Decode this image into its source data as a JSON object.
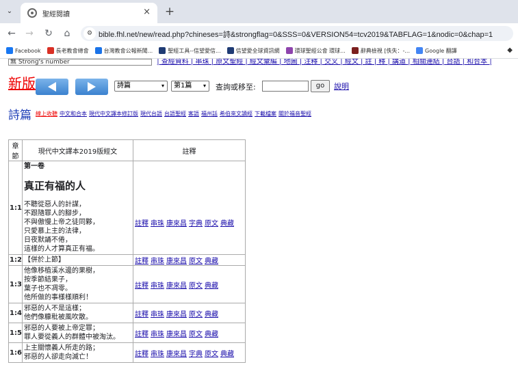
{
  "browser": {
    "tab_title": "聖經閱讀",
    "url": "bible.fhl.net/new/read.php?chineses=詩&strongflag=0&SSS=0&VERSION54=tcv2019&TABFLAG=1&nodic=0&chap=1",
    "bookmarks": [
      {
        "label": "Facebook",
        "color": "#1877f2"
      },
      {
        "label": "長老教會總會",
        "color": "#d93025"
      },
      {
        "label": "台灣教會公報新聞...",
        "color": "#1a73e8"
      },
      {
        "label": "聖經工具--信望愛信...",
        "color": "#1f3b74"
      },
      {
        "label": "信望愛全球資訊網",
        "color": "#1f3b74"
      },
      {
        "label": "環球聖經公會 環球...",
        "color": "#8e44ad"
      },
      {
        "label": "辭典檢視 [佚失：-...",
        "color": "#7b1f1f"
      },
      {
        "label": "Google 翻譯",
        "color": "#4285f4"
      }
    ]
  },
  "page": {
    "cutoff_select": "無 Strong's number",
    "cutoff_links": "| 查經資料 | 串珠 | 原文聖經 | 經文彙編 | 地圖 | 注釋 | 交叉 | 經文 | 註 | 釋 | 講道 | 相關連結 | 台語 | 和合本 |",
    "new_version": "新版",
    "book_select": "詩篇",
    "chapter_select": "第1篇",
    "goto_label": "查詢或移至:",
    "goto_value": "",
    "go_button": "go",
    "help_link": "說明",
    "book_title": "詩篇",
    "book_links": [
      {
        "label": "線上收聽",
        "red": true
      },
      {
        "label": "中文和合本",
        "red": false
      },
      {
        "label": "現代中文譯本修訂版",
        "red": false
      },
      {
        "label": "現代台語",
        "red": false
      },
      {
        "label": "台語聖經",
        "red": false
      },
      {
        "label": "客語",
        "red": false
      },
      {
        "label": "福州話",
        "red": false
      },
      {
        "label": "希伯來文讀經",
        "red": false
      },
      {
        "label": "下載檔案",
        "red": false
      },
      {
        "label": "關於福音聖經",
        "red": false
      }
    ]
  },
  "table": {
    "col_verse": "章節",
    "col_text": "現代中文譯本2019版經文",
    "col_notes": "註釋",
    "juan": "第一卷",
    "heading": "真正有福的人",
    "verses": [
      {
        "num": "1:1",
        "lines": [
          "不聽從惡人的計謀，",
          "不跟隨罪人的腳步，",
          "不與傲慢上帝之徒同夥，",
          "只愛慕上主的法律，",
          "日夜默誦不倦，",
          "這樣的人才算真正有福。"
        ],
        "notes": [
          "註釋",
          "串珠",
          "康來昌",
          "字典",
          "原文",
          "典藏"
        ]
      },
      {
        "num": "1:2",
        "lines": [
          "【併於上節】"
        ],
        "notes": [
          "註釋",
          "串珠",
          "康來昌",
          "原文",
          "典藏"
        ]
      },
      {
        "num": "1:3",
        "lines": [
          "他像移植溪水邊的果樹，",
          "按季節結果子，",
          "葉子也不凋零。",
          "他所做的事樣樣順利！"
        ],
        "notes": [
          "註釋",
          "串珠",
          "康來昌",
          "原文",
          "典藏"
        ]
      },
      {
        "num": "1:4",
        "lines": [
          "邪惡的人不是這樣；",
          "他們像糠秕被風吹散。"
        ],
        "notes": [
          "註釋",
          "串珠",
          "康來昌",
          "原文",
          "典藏"
        ]
      },
      {
        "num": "1:5",
        "lines": [
          "邪惡的人要被上帝定罪；",
          "罪人要從義人的群體中被淘汰。"
        ],
        "notes": [
          "註釋",
          "串珠",
          "康來昌",
          "原文",
          "典藏"
        ]
      },
      {
        "num": "1:6",
        "lines": [
          "上主關懷義人所走的路；",
          "邪惡的人卻走向滅亡！"
        ],
        "notes": [
          "註釋",
          "串珠",
          "康來昌",
          "字典",
          "原文",
          "典藏"
        ]
      }
    ]
  }
}
